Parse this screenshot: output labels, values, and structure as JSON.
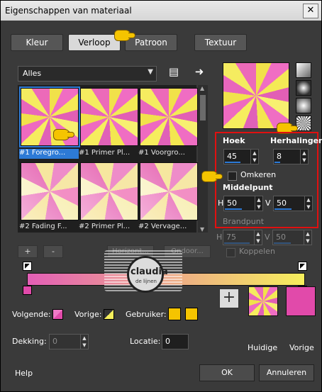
{
  "window": {
    "title": "Eigenschappen van materiaal",
    "close": "✕"
  },
  "tabs": [
    "Kleur",
    "Verloop",
    "Patroon",
    "Textuur"
  ],
  "dropdown": {
    "value": "Alles"
  },
  "gallery": {
    "thumbs": [
      {
        "label": "#1 Foregro..."
      },
      {
        "label": "#1 Primer Pl..."
      },
      {
        "label": "#1 Voorgro..."
      },
      {
        "label": "#2 Fading F..."
      },
      {
        "label": "#2 Primer Pl..."
      },
      {
        "label": "#2 Vervage..."
      }
    ]
  },
  "params": {
    "angle": {
      "label": "Hoek",
      "value": "45"
    },
    "repeats": {
      "label": "Herhalingen",
      "value": "8"
    },
    "invert": {
      "label": "Omkeren"
    },
    "midpoint": {
      "label": "Middelpunt",
      "h_label": "H",
      "h_value": "50",
      "v_label": "V",
      "v_value": "50"
    },
    "focal": {
      "label": "Brandpunt",
      "h_label": "H",
      "h_value": "75",
      "v_label": "V",
      "v_value": "50"
    },
    "link": {
      "label": "Koppelen"
    }
  },
  "buttons_small": {
    "plus": "+",
    "minus": "-"
  },
  "faded_buttons": {
    "left": "Horizont...",
    "right": "Ondoor..."
  },
  "watermark": {
    "text": "claudia",
    "subtext": "de lijnen"
  },
  "stops": {
    "next_label": "Volgende:",
    "prev_label": "Vorige:",
    "user_label": "Gebruiker:",
    "opacity_label": "Dekking:",
    "opacity_value": "0",
    "location_label": "Locatie:",
    "location_value": "0"
  },
  "current_label": "Huidige",
  "previous_label": "Vorige",
  "footer": {
    "help": "Help",
    "ok": "OK",
    "cancel": "Annuleren"
  },
  "colors": {
    "accent": "#2d7ad6",
    "highlight_box": "#e01010",
    "pink": "#e14aaa",
    "yellow": "#f6ef5c",
    "gold": "#f5c400"
  }
}
